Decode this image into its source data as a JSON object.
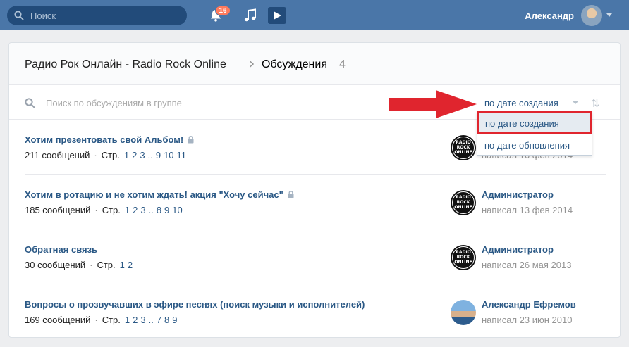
{
  "topbar": {
    "search_placeholder": "Поиск",
    "notifications_count": "16",
    "user_name": "Александр"
  },
  "header": {
    "group_name": "Радио Рок Онлайн - Radio Rock Online",
    "section": "Обсуждения",
    "count": "4"
  },
  "filter": {
    "placeholder": "Поиск по обсуждениям в группе"
  },
  "sort": {
    "current": "по дате создания",
    "options": [
      "по дате создания",
      "по дате обновления"
    ]
  },
  "topics": [
    {
      "title": "Хотим презентовать свой Альбом!",
      "locked": true,
      "messages": "211 сообщений",
      "pages_label": "Стр.",
      "pages": [
        "1",
        "2",
        "3",
        "..",
        "9",
        "10",
        "11"
      ],
      "author": "",
      "date": "написал 16 фев 2014"
    },
    {
      "title": "Хотим в ротацию и не хотим ждать! акция \"Хочу сейчас\"",
      "locked": true,
      "messages": "185 сообщений",
      "pages_label": "Стр.",
      "pages": [
        "1",
        "2",
        "3",
        "..",
        "8",
        "9",
        "10"
      ],
      "author": "Администратор",
      "date": "написал 13 фев 2014"
    },
    {
      "title": "Обратная связь",
      "locked": false,
      "messages": "30 сообщений",
      "pages_label": "Стр.",
      "pages": [
        "1",
        "2"
      ],
      "author": "Администратор",
      "date": "написал 26 мая 2013"
    },
    {
      "title": "Вопросы о прозвучавших в эфире песнях (поиск музыки и исполнителей)",
      "locked": false,
      "messages": "169 сообщений",
      "pages_label": "Стр.",
      "pages": [
        "1",
        "2",
        "3",
        "..",
        "7",
        "8",
        "9"
      ],
      "author": "Александр Ефремов",
      "date": "написал 23 июн 2010"
    }
  ],
  "avatar_logo_text": "RADIO ROCK ONLINE",
  "colors": {
    "topbar": "#4a76a8",
    "link": "#2a5885",
    "highlight_border": "#e0252e",
    "arrow": "#e0252e",
    "badge": "#ff7a5c"
  }
}
